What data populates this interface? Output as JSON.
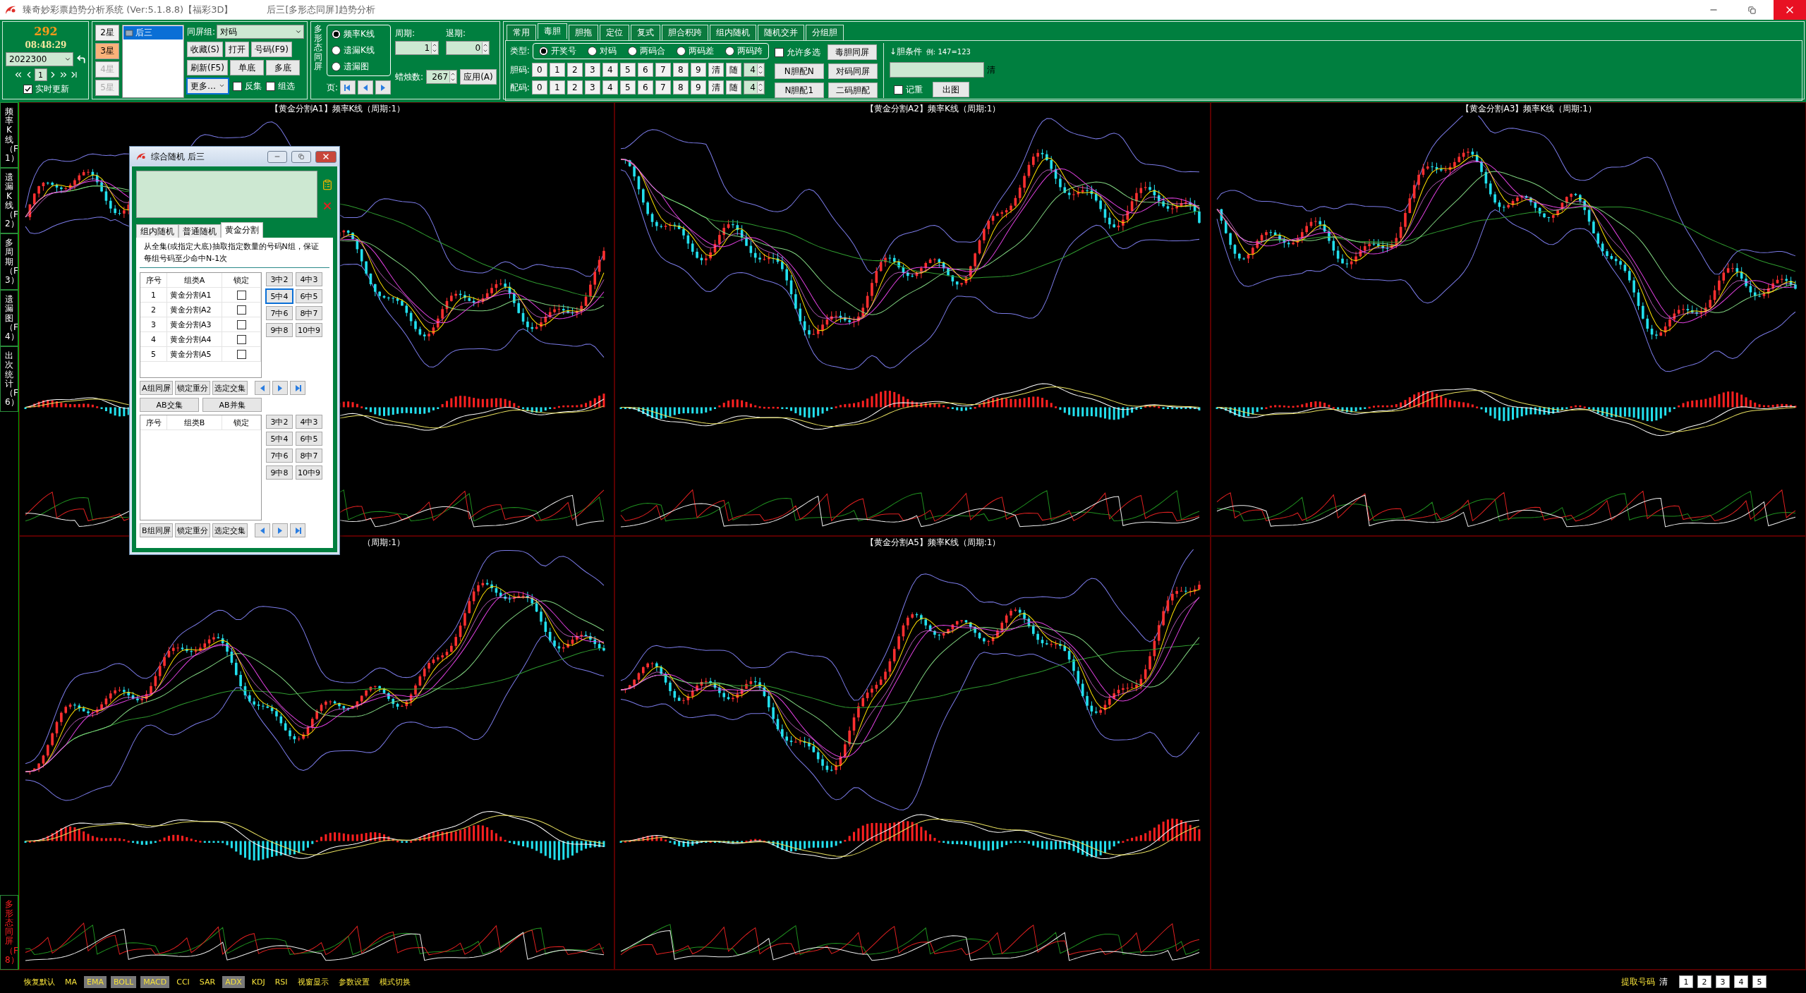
{
  "window": {
    "title": "臻奇妙彩票趋势分析系统 (Ver:5.1.8.8)【福彩3D】",
    "subtitle": "后三[多形态同屏]趋势分析"
  },
  "status_panel": {
    "count": "292",
    "time": "08:48:29",
    "period": "2022300",
    "page": "1",
    "realtime": {
      "label": "实时更新",
      "checked": true
    }
  },
  "star_buttons": [
    {
      "label": "2星",
      "selected": false,
      "disabled": false
    },
    {
      "label": "3星",
      "selected": true,
      "disabled": false
    },
    {
      "label": "4星",
      "selected": false,
      "disabled": true
    },
    {
      "label": "5星",
      "selected": false,
      "disabled": true
    }
  ],
  "plan_list": [
    {
      "label": "后三",
      "selected": true
    }
  ],
  "group": {
    "label": "同屏组:",
    "value": "对码"
  },
  "action_buttons": [
    "收藏(S)",
    "打开",
    "号码(F9)",
    "刷新(F5)",
    "单底",
    "多底"
  ],
  "more_button": "更多…",
  "options": [
    {
      "label": "反集",
      "checked": false
    },
    {
      "label": "组选",
      "checked": false
    }
  ],
  "multi_form": {
    "label": "多形态同屏",
    "modes": [
      {
        "label": "频率K线",
        "selected": true
      },
      {
        "label": "遗漏K线",
        "selected": false
      },
      {
        "label": "遗漏图",
        "selected": false
      }
    ],
    "page_label": "页:"
  },
  "period": {
    "label": "周期:",
    "value": "1"
  },
  "back_period": {
    "label": "退期:",
    "value": "0"
  },
  "candles": {
    "label": "蜡烛数:",
    "value": "267"
  },
  "apply_button": "应用(A)",
  "tabs": [
    {
      "label": "常用",
      "selected": false
    },
    {
      "label": "毒胆",
      "selected": true
    },
    {
      "label": "胆拖",
      "selected": false
    },
    {
      "label": "定位",
      "selected": false
    },
    {
      "label": "复式",
      "selected": false
    },
    {
      "label": "胆合积跨",
      "selected": false
    },
    {
      "label": "组内随机",
      "selected": false
    },
    {
      "label": "随机交并",
      "selected": false
    },
    {
      "label": "分组胆",
      "selected": false
    }
  ],
  "type_row": {
    "label": "类型:",
    "options": [
      {
        "label": "开奖号",
        "selected": true
      },
      {
        "label": "对码",
        "selected": false
      },
      {
        "label": "两码合",
        "selected": false
      },
      {
        "label": "两码差",
        "selected": false
      },
      {
        "label": "两码跨",
        "selected": false
      }
    ]
  },
  "allow_multi": {
    "label": "允许多选",
    "checked": false
  },
  "digit_rows": [
    {
      "label": "胆码:",
      "digits": [
        "0",
        "1",
        "2",
        "3",
        "4",
        "5",
        "6",
        "7",
        "8",
        "9"
      ],
      "clear": "清",
      "random": "随",
      "count": "4"
    },
    {
      "label": "配码:",
      "digits": [
        "0",
        "1",
        "2",
        "3",
        "4",
        "5",
        "6",
        "7",
        "8",
        "9"
      ],
      "clear": "清",
      "random": "随",
      "count": "4"
    }
  ],
  "side_buttons": [
    "毒胆同屏",
    "N胆配N",
    "对码同屏",
    "N胆配1",
    "二码胆配"
  ],
  "condition": {
    "label": "↓胆条件",
    "example": "例: 147=123",
    "clear": "清",
    "record": {
      "label": "记重",
      "checked": false
    },
    "chart_button": "出图"
  },
  "sidebar": [
    {
      "label": "频率K线（F1）",
      "selected": false
    },
    {
      "label": "遗漏K线（F2）",
      "selected": false
    },
    {
      "label": "多周期（F3）",
      "selected": false
    },
    {
      "label": "遗漏图（F4）",
      "selected": false
    },
    {
      "label": "出次统计（F6）",
      "selected": false
    },
    {
      "label": "多形态同屏（F8）",
      "selected": true
    }
  ],
  "charts": [
    {
      "title": "【黄金分割A1】频率K线（周期:1）"
    },
    {
      "title": "【黄金分割A2】频率K线（周期:1）"
    },
    {
      "title": "【黄金分割A3】频率K线（周期:1）"
    },
    {
      "title": "（周期:1）"
    },
    {
      "title": "【黄金分割A5】频率K线（周期:1）"
    }
  ],
  "dialog": {
    "title": "综合随机 后三",
    "tabs": [
      {
        "label": "组内随机",
        "selected": false
      },
      {
        "label": "普通随机",
        "selected": false
      },
      {
        "label": "黄金分割",
        "selected": true
      }
    ],
    "description": "从全集(或指定大底)抽取指定数量的号码N组，保证每组号码至少命中N-1次",
    "table_a": {
      "columns": [
        "序号",
        "组类A",
        "锁定"
      ],
      "rows": [
        {
          "index": "1",
          "name": "黄金分割A1",
          "locked": false
        },
        {
          "index": "2",
          "name": "黄金分割A2",
          "locked": false
        },
        {
          "index": "3",
          "name": "黄金分割A3",
          "locked": false
        },
        {
          "index": "4",
          "name": "黄金分割A4",
          "locked": false
        },
        {
          "index": "5",
          "name": "黄金分割A5",
          "locked": false
        }
      ]
    },
    "ratio_a": [
      {
        "label": "3中2",
        "selected": false
      },
      {
        "label": "4中3",
        "selected": false
      },
      {
        "label": "5中4",
        "selected": true
      },
      {
        "label": "6中5",
        "selected": false
      },
      {
        "label": "7中6",
        "selected": false
      },
      {
        "label": "8中7",
        "selected": false
      },
      {
        "label": "9中8",
        "selected": false
      },
      {
        "label": "10中9",
        "selected": false
      }
    ],
    "buttons_a": [
      "A组同屏",
      "锁定重分",
      "选定交集"
    ],
    "ab_buttons": [
      "AB交集",
      "AB并集"
    ],
    "table_b": {
      "columns": [
        "序号",
        "组类B",
        "锁定"
      ]
    },
    "ratio_b": [
      {
        "label": "3中2",
        "selected": false
      },
      {
        "label": "4中3",
        "selected": false
      },
      {
        "label": "5中4",
        "selected": false
      },
      {
        "label": "6中5",
        "selected": false
      },
      {
        "label": "7中6",
        "selected": false
      },
      {
        "label": "8中7",
        "selected": false
      },
      {
        "label": "9中8",
        "selected": false
      },
      {
        "label": "10中9",
        "selected": false
      }
    ],
    "buttons_b": [
      "B组同屏",
      "锁定重分",
      "选定交集"
    ]
  },
  "bottom_bar": {
    "items": [
      {
        "label": "恢复默认",
        "on": false
      },
      {
        "label": "MA",
        "on": false
      },
      {
        "label": "EMA",
        "on": true
      },
      {
        "label": "BOLL",
        "on": true
      },
      {
        "label": "MACD",
        "on": true
      },
      {
        "label": "CCI",
        "on": false
      },
      {
        "label": "SAR",
        "on": false
      },
      {
        "label": "ADX",
        "on": true
      },
      {
        "label": "KDJ",
        "on": false
      },
      {
        "label": "RSI",
        "on": false
      },
      {
        "label": "视窗显示",
        "on": false
      },
      {
        "label": "参数设置",
        "on": false
      },
      {
        "label": "模式切换",
        "on": false
      }
    ],
    "extract_label": "提取号码",
    "clear": "清",
    "pages": [
      "1",
      "2",
      "3",
      "4",
      "5"
    ]
  }
}
